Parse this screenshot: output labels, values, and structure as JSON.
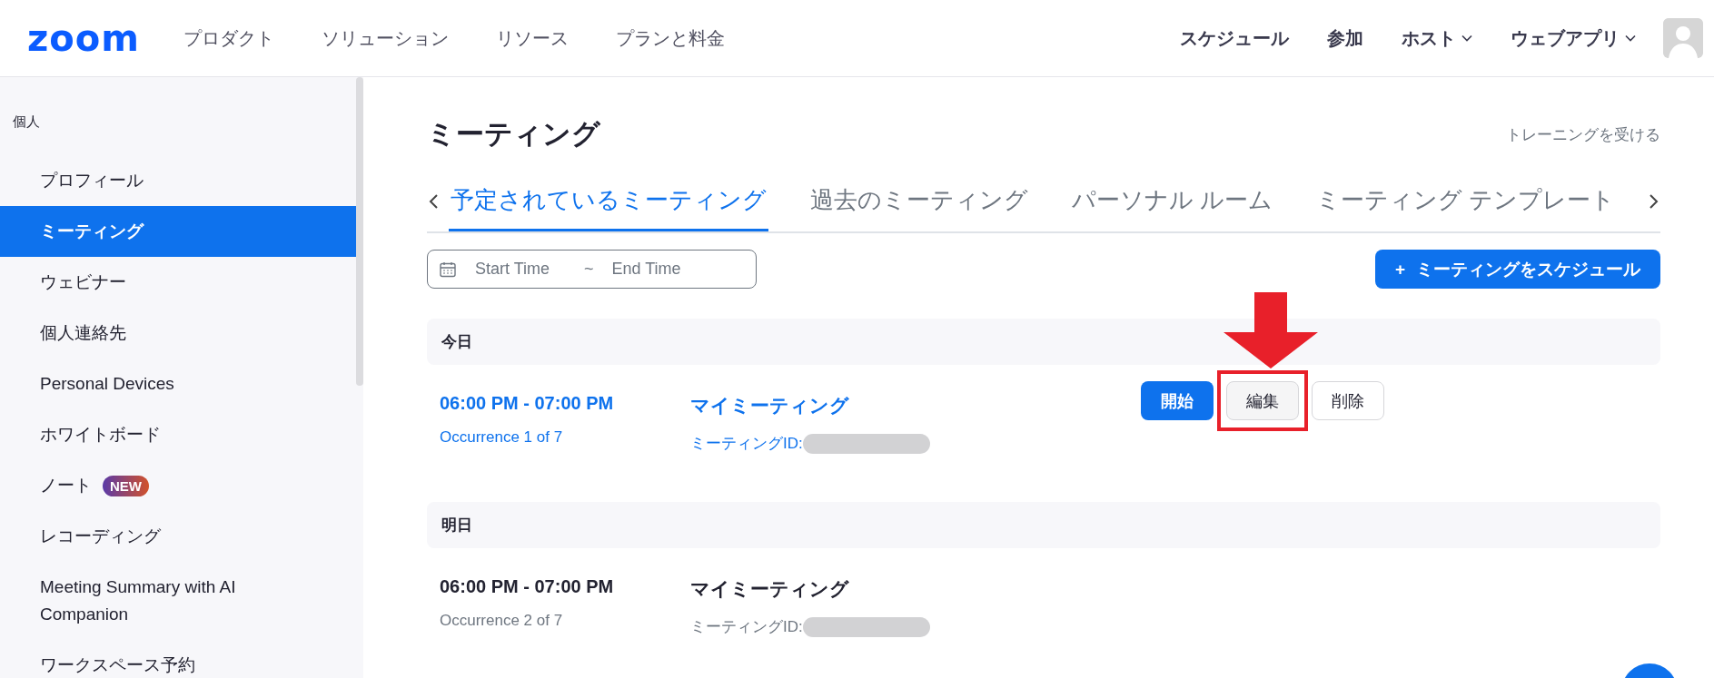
{
  "header": {
    "logo": "zoom",
    "nav_left": [
      {
        "label": "プロダクト"
      },
      {
        "label": "ソリューション"
      },
      {
        "label": "リソース"
      },
      {
        "label": "プランと料金"
      }
    ],
    "nav_right": [
      {
        "label": "スケジュール",
        "dropdown": false
      },
      {
        "label": "参加",
        "dropdown": false
      },
      {
        "label": "ホスト",
        "dropdown": true
      },
      {
        "label": "ウェブアプリ",
        "dropdown": true
      }
    ]
  },
  "sidebar": {
    "section": "個人",
    "items": [
      {
        "label": "プロフィール",
        "selected": false
      },
      {
        "label": "ミーティング",
        "selected": true
      },
      {
        "label": "ウェビナー",
        "selected": false
      },
      {
        "label": "個人連絡先",
        "selected": false
      },
      {
        "label": "Personal Devices",
        "selected": false
      },
      {
        "label": "ホワイトボード",
        "selected": false
      },
      {
        "label": "ノート",
        "selected": false,
        "badge": "NEW"
      },
      {
        "label": "レコーディング",
        "selected": false
      },
      {
        "label": "Meeting Summary with AI Companion",
        "selected": false
      },
      {
        "label": "ワークスペース予約",
        "selected": false
      }
    ]
  },
  "main": {
    "title": "ミーティング",
    "training_link": "トレーニングを受ける",
    "tabs": [
      {
        "label": "予定されているミーティング",
        "selected": true
      },
      {
        "label": "過去のミーティング",
        "selected": false
      },
      {
        "label": "パーソナル ルーム",
        "selected": false
      },
      {
        "label": "ミーティング テンプレート",
        "selected": false
      }
    ],
    "date_filter": {
      "start_placeholder": "Start Time",
      "separator": "~",
      "end_placeholder": "End Time"
    },
    "schedule_button": {
      "icon": "+",
      "label": "ミーティングをスケジュール"
    },
    "groups": [
      {
        "day": "今日",
        "meetings": [
          {
            "time": "06:00 PM - 07:00 PM",
            "occurrence": "Occurrence 1 of 7",
            "topic": "マイミーティング",
            "id_label": "ミーティングID:",
            "current": true,
            "actions": [
              {
                "label": "開始",
                "kind": "primary",
                "highlighted": false
              },
              {
                "label": "編集",
                "kind": "secondary",
                "highlighted": true
              },
              {
                "label": "削除",
                "kind": "secondary",
                "highlighted": false
              }
            ]
          }
        ]
      },
      {
        "day": "明日",
        "meetings": [
          {
            "time": "06:00 PM - 07:00 PM",
            "occurrence": "Occurrence 2 of 7",
            "topic": "マイミーティング",
            "id_label": "ミーティングID:",
            "current": false
          }
        ]
      }
    ]
  }
}
